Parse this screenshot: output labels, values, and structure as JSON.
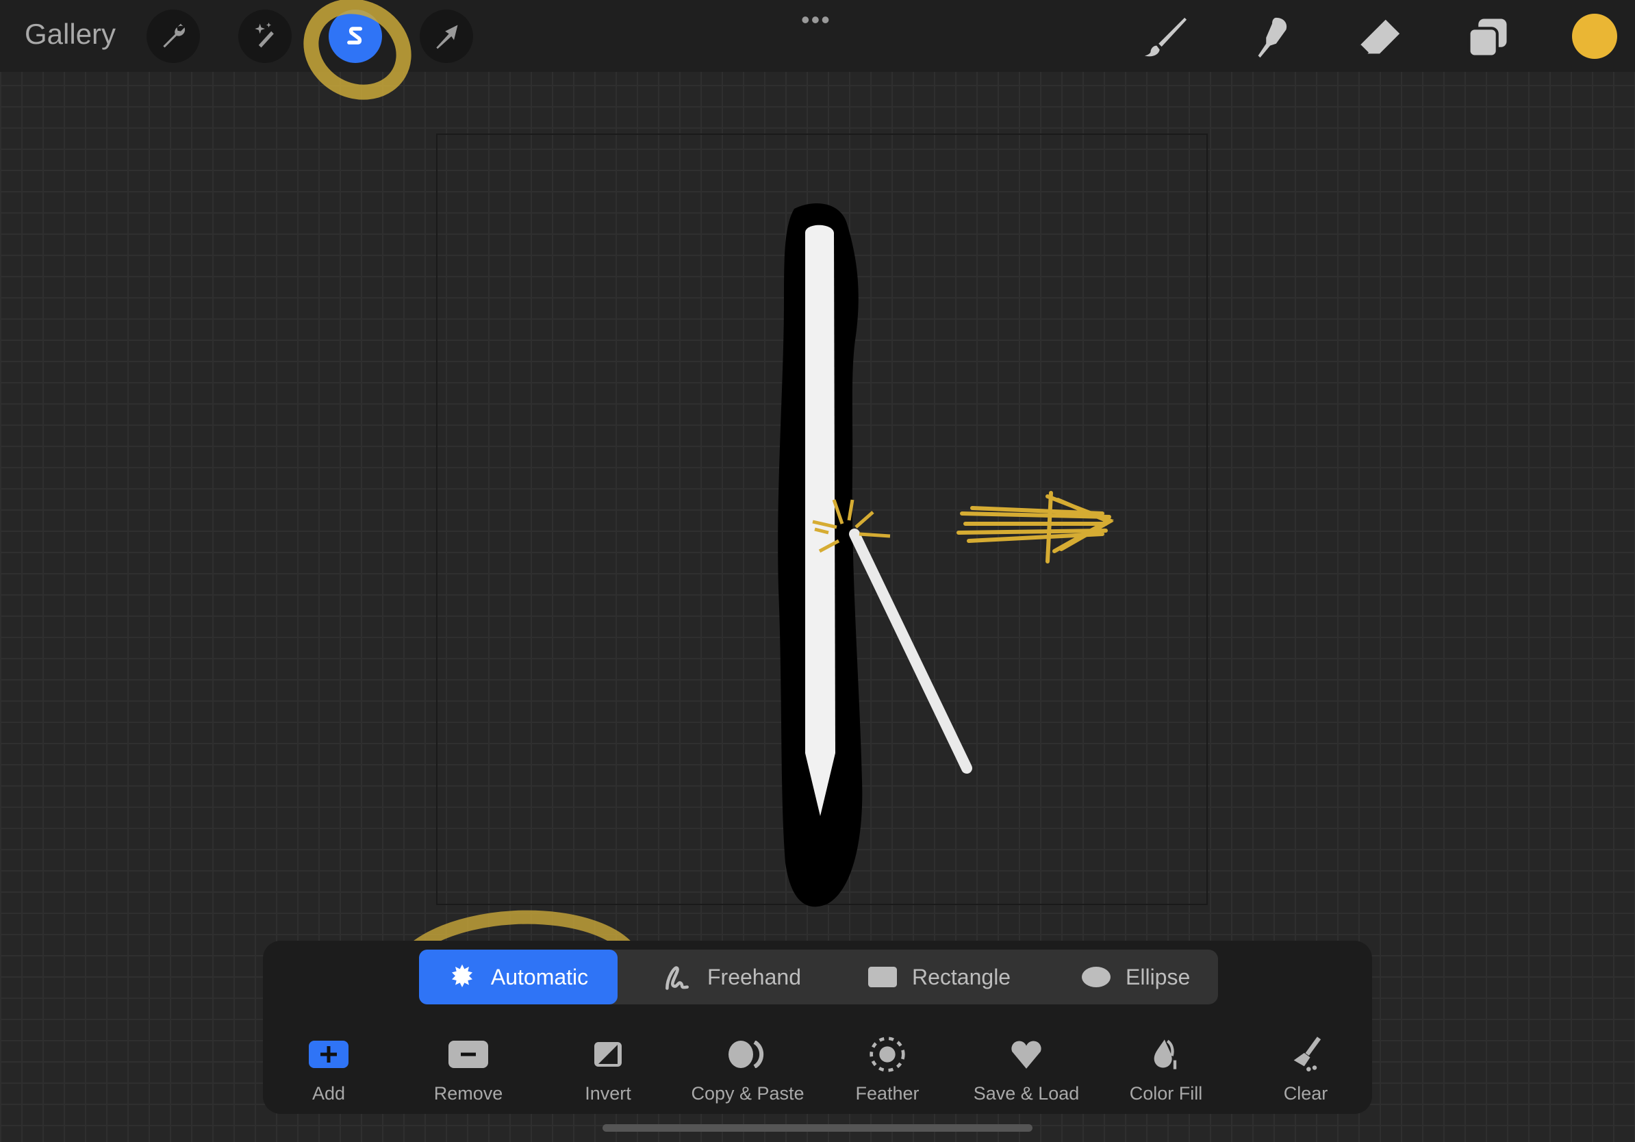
{
  "topbar": {
    "gallery_label": "Gallery",
    "more_label": "•••",
    "left_tools": [
      {
        "name": "adjustments",
        "icon": "wrench-icon"
      },
      {
        "name": "adjustments-magic",
        "icon": "magic-wand-icon"
      },
      {
        "name": "selection",
        "icon": "selection-icon",
        "active": true
      },
      {
        "name": "transform",
        "icon": "arrow-cursor-icon"
      }
    ],
    "right_tools": [
      {
        "name": "brush",
        "icon": "brush-icon"
      },
      {
        "name": "smudge",
        "icon": "smudge-icon"
      },
      {
        "name": "eraser",
        "icon": "eraser-icon"
      },
      {
        "name": "layers",
        "icon": "layers-icon"
      }
    ],
    "current_color": "#eab634"
  },
  "selection_panel": {
    "modes": [
      {
        "label": "Automatic",
        "icon": "starburst-icon",
        "active": true
      },
      {
        "label": "Freehand",
        "icon": "freehand-icon"
      },
      {
        "label": "Rectangle",
        "icon": "rectangle-icon"
      },
      {
        "label": "Ellipse",
        "icon": "ellipse-icon"
      }
    ],
    "tools": [
      {
        "label": "Add",
        "icon": "plus-icon"
      },
      {
        "label": "Remove",
        "icon": "minus-icon"
      },
      {
        "label": "Invert",
        "icon": "invert-icon"
      },
      {
        "label": "Copy & Paste",
        "icon": "copy-paste-icon"
      },
      {
        "label": "Feather",
        "icon": "feather-icon"
      },
      {
        "label": "Save & Load",
        "icon": "heart-icon"
      },
      {
        "label": "Color Fill",
        "icon": "color-fill-icon"
      },
      {
        "label": "Clear",
        "icon": "clear-brush-icon"
      }
    ]
  },
  "colors": {
    "accent": "#2f74f6",
    "highlight": "#c9a83a"
  }
}
